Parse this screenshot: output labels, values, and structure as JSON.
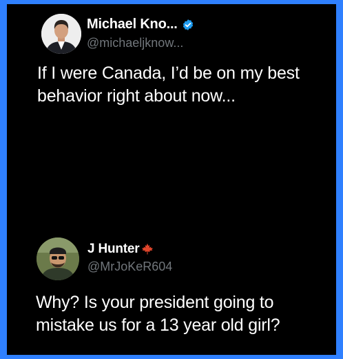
{
  "colors": {
    "frame_border": "#2f80ff",
    "background": "#000000",
    "name_text": "#ffffff",
    "handle_text": "#71767b",
    "verified_badge": "#1d9bf0",
    "maple_leaf": "#e0452b"
  },
  "posts": [
    {
      "display_name": "Michael Kno...",
      "verified_icon": "verified-badge-icon",
      "handle": "@michaeljknow...",
      "text": "If I were Canada, I’d be on my best behavior right about now..."
    },
    {
      "display_name": "J Hunter",
      "flag_icon": "maple-leaf-icon",
      "handle": "@MrJoKeR604",
      "text": "Why? Is your president going to mistake us for a 13 year old girl?"
    }
  ]
}
